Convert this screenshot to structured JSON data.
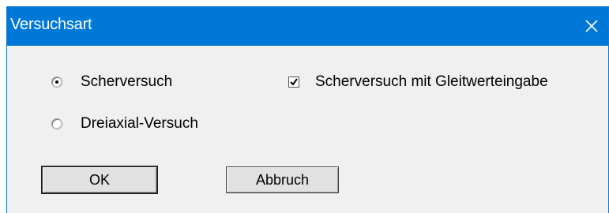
{
  "dialog": {
    "title": "Versuchsart",
    "close_icon": "close-icon",
    "options": {
      "scherversuch_label": "Scherversuch",
      "scherversuch_selected": true,
      "dreiaxial_label": "Dreiaxial-Versuch",
      "dreiaxial_selected": false,
      "gleitwert_label": "Scherversuch mit Gleitwerteingabe",
      "gleitwert_checked": true
    },
    "buttons": {
      "ok_label": "OK",
      "cancel_label": "Abbruch"
    },
    "colors": {
      "titlebar": "#0078d7",
      "body": "#f0f0f0"
    }
  }
}
